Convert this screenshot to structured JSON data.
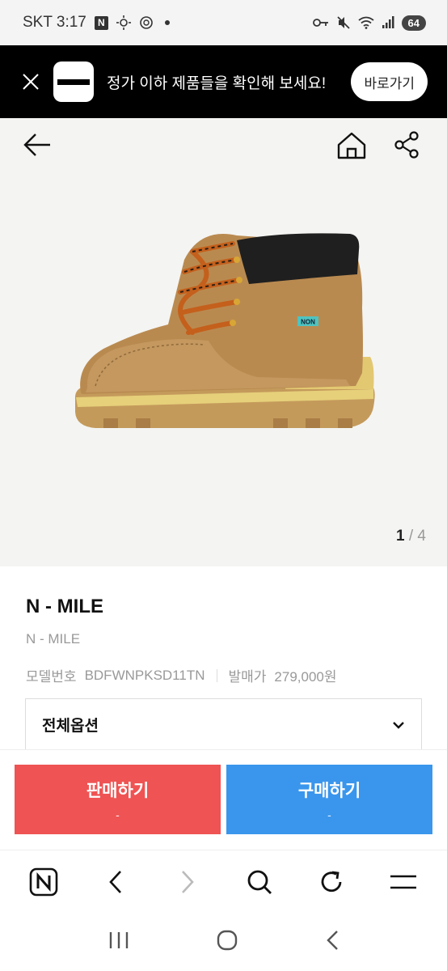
{
  "status": {
    "carrier_time": "SKT 3:17",
    "n_badge": "N",
    "battery": "64"
  },
  "banner": {
    "message": "정가 이하 제품들을 확인해 보세요!",
    "button": "바로가기"
  },
  "gallery": {
    "current": "1",
    "separator": " / ",
    "total": "4",
    "tongue_tag": "NON"
  },
  "product": {
    "title": "N - MILE",
    "subtitle": "N - MILE",
    "model_label": "모델번호",
    "model_value": "BDFWNPKSD11TN",
    "release_label": "발매가",
    "release_value": "279,000원",
    "option_label": "전체옵션"
  },
  "actions": {
    "sell_label": "판매하기",
    "sell_price": "-",
    "buy_label": "구매하기",
    "buy_price": "-",
    "sell_color": "#ef5353",
    "buy_color": "#3a96ec"
  },
  "browser": {
    "logo": "N"
  },
  "icons": [
    "close-icon",
    "back-arrow-icon",
    "home-icon",
    "share-icon",
    "chevron-down-icon",
    "naver-logo-icon",
    "browser-back-icon",
    "browser-forward-icon",
    "search-icon",
    "refresh-icon",
    "menu-icon",
    "recents-icon",
    "home-circle-icon",
    "system-back-icon"
  ]
}
